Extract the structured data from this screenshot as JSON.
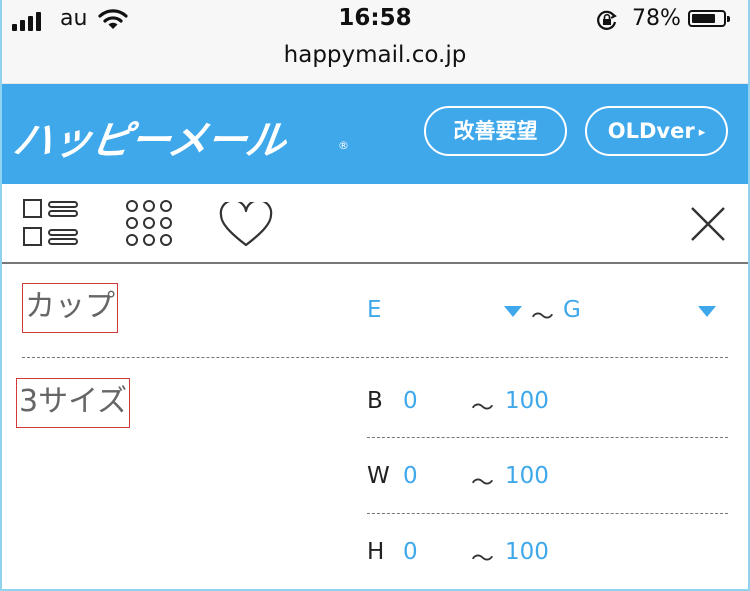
{
  "status_bar": {
    "carrier": "au",
    "time": "16:58",
    "battery_percent": "78%",
    "battery_level": 0.78,
    "icons": [
      "signal-icon",
      "wifi-icon",
      "rotation-lock-icon",
      "battery-icon"
    ]
  },
  "browser": {
    "url": "happymail.co.jp"
  },
  "header": {
    "logo_text": "ハッピーメール",
    "logo_mark": "®",
    "kaizen_label": "改善要望",
    "old_label": "OLDver",
    "old_arrow": "▸",
    "color": "#3fa8eb"
  },
  "toolbar": {
    "icons": [
      "list-view-icon",
      "grid-view-icon",
      "heart-icon",
      "close-icon"
    ]
  },
  "cup": {
    "label": "カップ",
    "from": "E",
    "tilde": "〜",
    "to": "G"
  },
  "three_sizes": {
    "label": "3サイズ",
    "rows": [
      {
        "key": "B",
        "min": "0",
        "tilde": "〜",
        "max": "100"
      },
      {
        "key": "W",
        "min": "0",
        "tilde": "〜",
        "max": "100"
      },
      {
        "key": "H",
        "min": "0",
        "tilde": "〜",
        "max": "100"
      }
    ]
  }
}
